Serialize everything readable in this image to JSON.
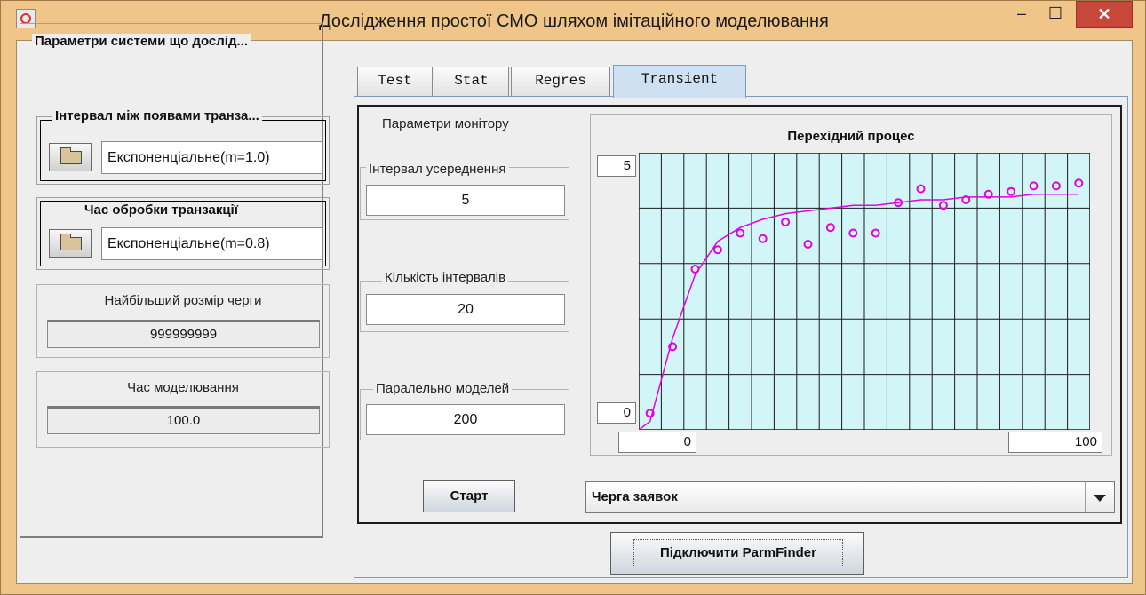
{
  "window": {
    "title": "Дослідження простої СМО шляхом імітаційного моделювання",
    "controls": {
      "minimize": "–",
      "maximize": "☐",
      "close": "✕"
    }
  },
  "left_panel": {
    "title": "Параметри системи що дослід...",
    "arrival": {
      "title": "Інтервал між появами транза...",
      "value": "Експоненціальне(m=1.0)",
      "icon": "folder-icon"
    },
    "service": {
      "title": "Час обробки транзакції",
      "value": "Експоненціальне(m=0.8)",
      "icon": "folder-icon"
    },
    "max_queue": {
      "label": "Найбільший розмір черги",
      "value": "999999999"
    },
    "sim_time": {
      "label": "Час моделювання",
      "value": "100.0"
    }
  },
  "tabs": [
    {
      "label": "Test"
    },
    {
      "label": "Stat"
    },
    {
      "label": "Regres"
    },
    {
      "label": "Transient",
      "active": true
    }
  ],
  "monitor": {
    "title": "Параметри монітору",
    "avg_interval": {
      "label": "Інтервал усереднення",
      "value": "5"
    },
    "intervals": {
      "label": "Кількість інтервалів",
      "value": "20"
    },
    "parallel": {
      "label": "Паралельно моделей",
      "value": "200"
    }
  },
  "chart": {
    "y_top": "5",
    "y_bottom": "0",
    "x_left": "0",
    "x_right": "100"
  },
  "chart_data": {
    "type": "scatter",
    "title": "Перехідний процес",
    "xlim": [
      0,
      100
    ],
    "ylim": [
      0,
      5
    ],
    "x": [
      2.5,
      7.5,
      12.5,
      17.5,
      22.5,
      27.5,
      32.5,
      37.5,
      42.5,
      47.5,
      52.5,
      57.5,
      62.5,
      67.5,
      72.5,
      77.5,
      82.5,
      87.5,
      92.5,
      97.5
    ],
    "series": [
      {
        "values": [
          0.15,
          1.65,
          2.8,
          3.4,
          3.65,
          3.8,
          3.9,
          3.95,
          4.0,
          4.05,
          4.05,
          4.1,
          4.15,
          4.15,
          4.2,
          4.2,
          4.2,
          4.25,
          4.25,
          4.25
        ],
        "style": "fit-line"
      },
      {
        "values": [
          0.3,
          1.5,
          2.9,
          3.25,
          3.55,
          3.45,
          3.75,
          3.35,
          3.65,
          3.55,
          3.55,
          4.1,
          4.35,
          4.05,
          4.15,
          4.25,
          4.3,
          4.4,
          4.4,
          4.45
        ],
        "style": "markers"
      }
    ],
    "colors": {
      "series": "#e400e4",
      "plot_bg": "#d2f5f7",
      "grid": "#1a1a1a"
    },
    "grid": true
  },
  "controls": {
    "start": "Старт",
    "queue_select": "Черга заявок",
    "connect": "Підключити ParmFinder"
  }
}
